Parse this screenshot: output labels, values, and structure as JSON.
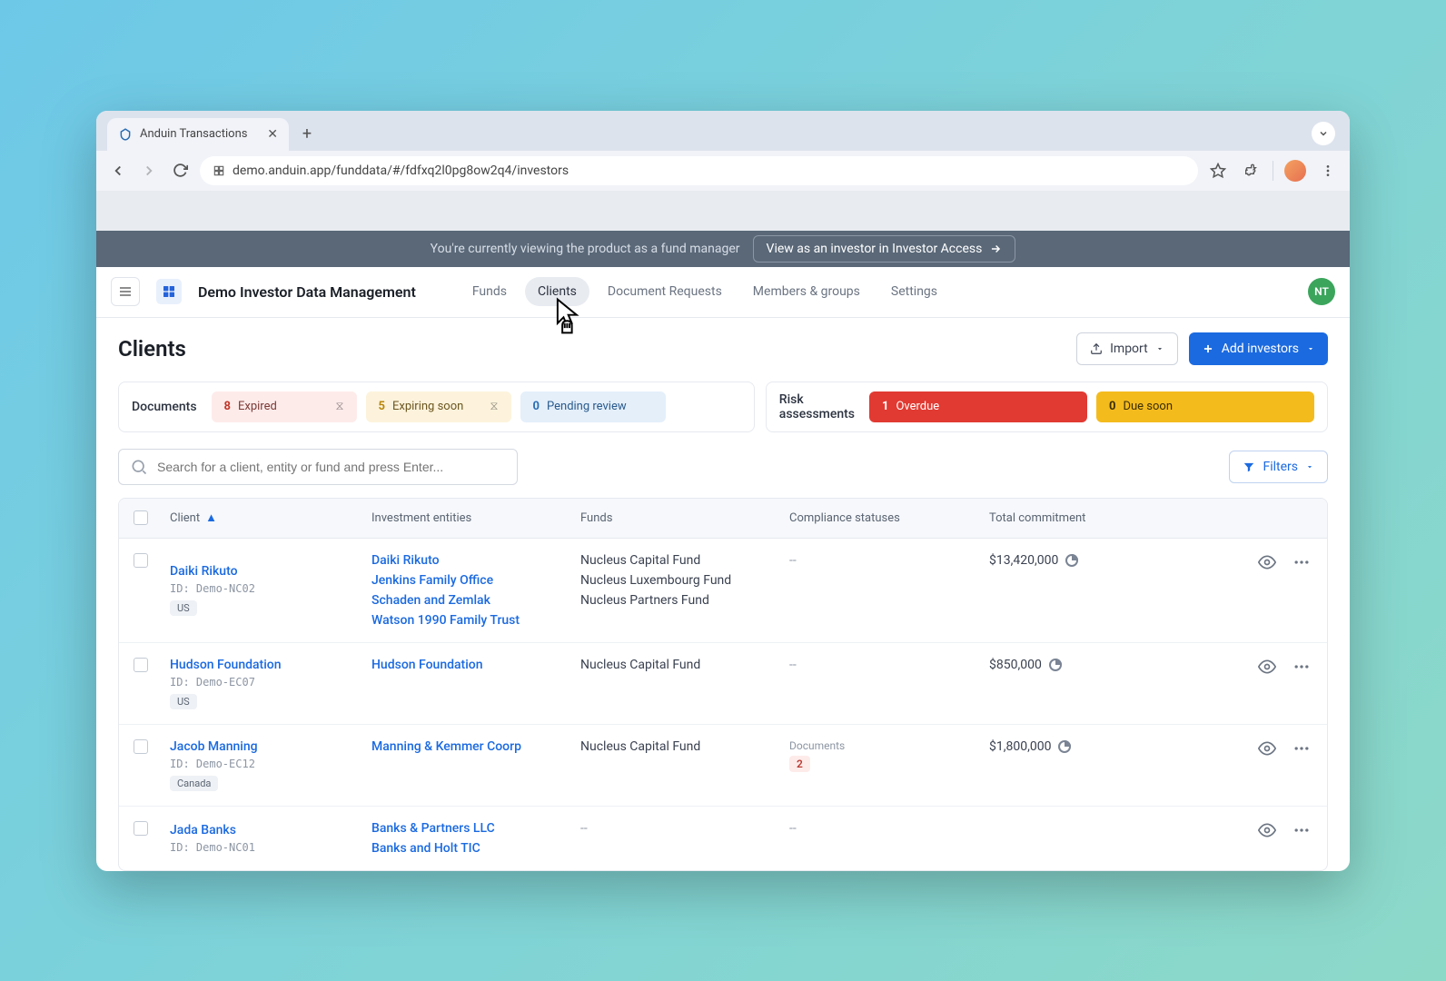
{
  "browser": {
    "tab_title": "Anduin Transactions",
    "url": "demo.anduin.app/funddata/#/fdfxq2l0pg8ow2q4/investors"
  },
  "banner": {
    "text": "You're currently viewing the product as a fund manager",
    "button": "View as an investor in Investor Access"
  },
  "app": {
    "title": "Demo Investor Data Management",
    "nav": [
      "Funds",
      "Clients",
      "Document Requests",
      "Members & groups",
      "Settings"
    ],
    "avatar": "NT"
  },
  "page": {
    "title": "Clients",
    "import": "Import",
    "add": "Add investors"
  },
  "status": {
    "documents_label": "Documents",
    "expired": {
      "count": "8",
      "label": "Expired"
    },
    "expiring": {
      "count": "5",
      "label": "Expiring soon"
    },
    "pending": {
      "count": "0",
      "label": "Pending review"
    },
    "risk_label": "Risk assessments",
    "overdue": {
      "count": "1",
      "label": "Overdue"
    },
    "due": {
      "count": "0",
      "label": "Due soon"
    }
  },
  "search": {
    "placeholder": "Search for a client, entity or fund and press Enter..."
  },
  "filters_label": "Filters",
  "columns": {
    "client": "Client",
    "entities": "Investment entities",
    "funds": "Funds",
    "compliance": "Compliance statuses",
    "commitment": "Total commitment"
  },
  "rows": [
    {
      "client": "Daiki Rikuto",
      "id": "ID: Demo-NC02",
      "country": "US",
      "entities": [
        "Daiki Rikuto",
        "Jenkins Family Office",
        "Schaden and Zemlak",
        "Watson 1990 Family Trust"
      ],
      "funds": [
        "Nucleus Capital Fund",
        "Nucleus Luxembourg Fund",
        "Nucleus Partners Fund"
      ],
      "compliance": "--",
      "commitment": "$13,420,000"
    },
    {
      "client": "Hudson Foundation",
      "id": "ID: Demo-EC07",
      "country": "US",
      "entities": [
        "Hudson Foundation"
      ],
      "funds": [
        "Nucleus Capital Fund"
      ],
      "compliance": "--",
      "commitment": "$850,000"
    },
    {
      "client": "Jacob Manning",
      "id": "ID: Demo-EC12",
      "country": "Canada",
      "entities": [
        "Manning & Kemmer Coorp"
      ],
      "funds": [
        "Nucleus Capital Fund"
      ],
      "compliance_label": "Documents",
      "compliance_badge": "2",
      "commitment": "$1,800,000"
    },
    {
      "client": "Jada Banks",
      "id": "ID: Demo-NC01",
      "country": "",
      "entities": [
        "Banks & Partners LLC",
        "Banks and Holt TIC"
      ],
      "funds": [
        "--"
      ],
      "compliance": "--",
      "commitment": ""
    }
  ]
}
